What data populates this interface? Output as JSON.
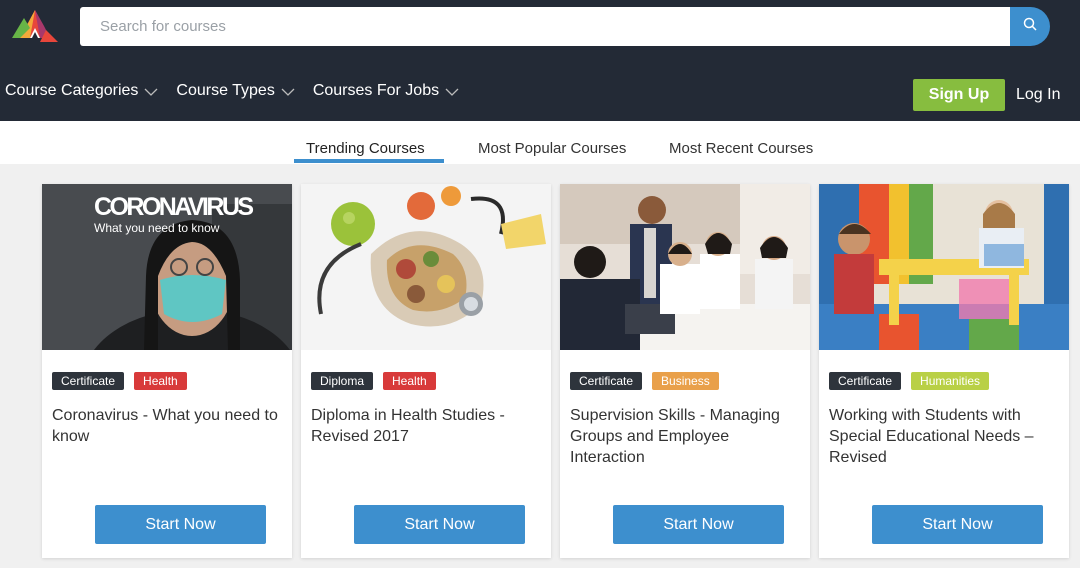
{
  "search": {
    "placeholder": "Search for courses"
  },
  "nav": {
    "items": [
      {
        "label": "Course Categories"
      },
      {
        "label": "Course Types"
      },
      {
        "label": "Courses For Jobs"
      }
    ],
    "signup_label": "Sign Up",
    "login_label": "Log In"
  },
  "tabs": [
    {
      "label": "Trending Courses",
      "active": true
    },
    {
      "label": "Most Popular Courses",
      "active": false
    },
    {
      "label": "Most Recent Courses",
      "active": false
    }
  ],
  "colors": {
    "header_bg": "#232a36",
    "accent_blue": "#3d8fce",
    "signup_green": "#87bd3f",
    "tag_dark": "#2e343c",
    "tag_health": "#d83a3a",
    "tag_business": "#e9a04a",
    "tag_humanities": "#b9d046"
  },
  "courses": [
    {
      "image_icon": "coronavirus-photo",
      "image_text_title": "CORONAVIRUS",
      "image_text_sub": "What you need to know",
      "tags": [
        "Certificate",
        "Health"
      ],
      "title": "Coronavirus - What you need to know",
      "button": "Start Now"
    },
    {
      "image_icon": "health-food-stethoscope-photo",
      "tags": [
        "Diploma",
        "Health"
      ],
      "title": "Diploma in Health Studies - Revised 2017",
      "button": "Start Now"
    },
    {
      "image_icon": "business-meeting-photo",
      "tags": [
        "Certificate",
        "Business"
      ],
      "title": "Supervision Skills - Managing Groups and Employee Interaction",
      "button": "Start Now"
    },
    {
      "image_icon": "classroom-children-photo",
      "tags": [
        "Certificate",
        "Humanities"
      ],
      "title": "Working with Students with Special Educational Needs – Revised",
      "button": "Start Now"
    }
  ]
}
